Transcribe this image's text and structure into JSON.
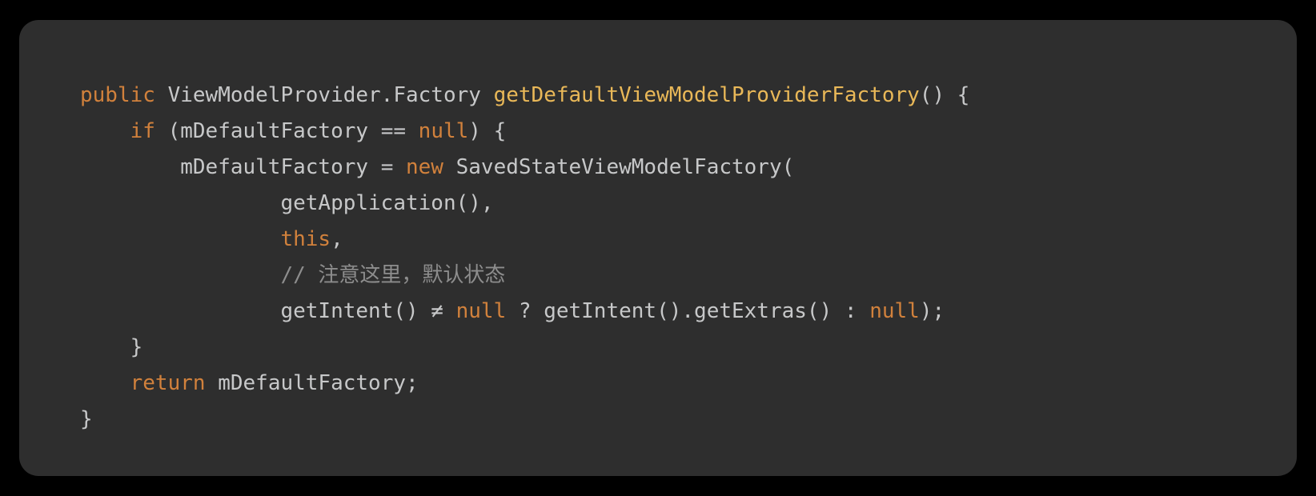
{
  "code": {
    "line1": {
      "kw_public": "public",
      "type": "ViewModelProvider.Factory",
      "method": "getDefaultViewModelProviderFactory",
      "tail": "() {"
    },
    "line2": {
      "indent": "    ",
      "kw_if": "if",
      "cond_open": " (mDefaultFactory == ",
      "null": "null",
      "cond_close": ") {"
    },
    "line3": {
      "indent": "        ",
      "assign": "mDefaultFactory = ",
      "kw_new": "new",
      "ctor": " SavedStateViewModelFactory("
    },
    "line4": {
      "indent": "                ",
      "text": "getApplication(),"
    },
    "line5": {
      "indent": "                ",
      "kw_this": "this",
      "comma": ","
    },
    "line6": {
      "indent": "                ",
      "comment": "// 注意这里，默认状态"
    },
    "line7": {
      "indent": "                ",
      "part1": "getIntent() ≠ ",
      "null1": "null",
      "part2": " ? getIntent().getExtras() : ",
      "null2": "null",
      "part3": ");"
    },
    "line8": {
      "indent": "    ",
      "brace": "}"
    },
    "line9": {
      "indent": "    ",
      "kw_return": "return",
      "text": " mDefaultFactory;"
    },
    "line10": {
      "brace": "}"
    }
  }
}
